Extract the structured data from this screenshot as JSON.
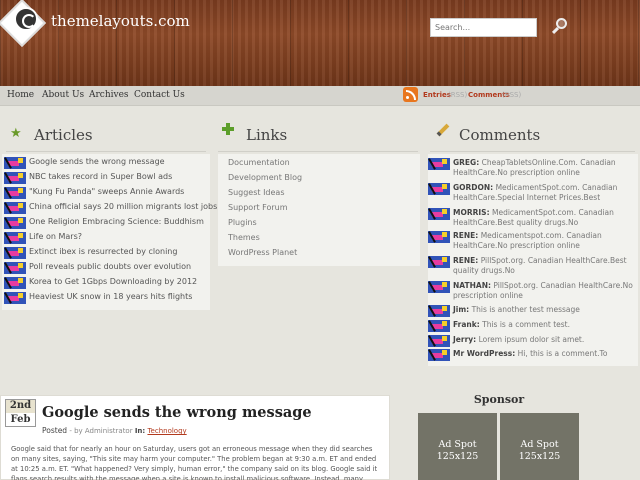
{
  "site": {
    "title": "themelayouts.com"
  },
  "search": {
    "placeholder": "Search..."
  },
  "nav": {
    "items": [
      "Home",
      "About Us",
      "Archives",
      "Contact Us"
    ]
  },
  "rss": {
    "entries": "Entries",
    "entries_tag": "(RSS)",
    "comments": "Comments",
    "comments_tag": "(RSS)"
  },
  "articles": {
    "title": "Articles",
    "items": [
      "Google sends the wrong message",
      "NBC takes record in Super Bowl ads",
      "\"Kung Fu Panda\" sweeps Annie Awards",
      "China official says 20 million migrants lost jobs",
      "One Religion Embracing Science: Buddhism",
      "Life on Mars?",
      "Extinct ibex is resurrected by cloning",
      "Poll reveals public doubts over evolution",
      "Korea to Get 1Gbps Downloading by 2012",
      "Heaviest UK snow in 18 years hits flights"
    ]
  },
  "links": {
    "title": "Links",
    "items": [
      "Documentation",
      "Development Blog",
      "Suggest Ideas",
      "Support Forum",
      "Plugins",
      "Themes",
      "WordPress Planet"
    ]
  },
  "comments": {
    "title": "Comments",
    "items": [
      {
        "author": "GREG:",
        "text": "CheapTabletsOnline.Com. Canadian HealthCare.No prescription online"
      },
      {
        "author": "GORDON:",
        "text": "MedicamentSpot.com. Canadian HealthCare.Special Internet Prices.Best"
      },
      {
        "author": "MORRIS:",
        "text": "MedicamentSpot.com. Canadian HealthCare.Best quality drugs.No"
      },
      {
        "author": "RENE:",
        "text": "Medicamentspot.com. Canadian HealthCare.No prescription online"
      },
      {
        "author": "RENE:",
        "text": "PillSpot.org. Canadian HealthCare.Best quality drugs.No"
      },
      {
        "author": "NATHAN:",
        "text": "PillSpot.org. Canadian HealthCare.No prescription online"
      },
      {
        "author": "Jim:",
        "text": "This is another test message"
      },
      {
        "author": "Frank:",
        "text": "This is a comment test."
      },
      {
        "author": "Jerry:",
        "text": "Lorem ipsum dolor sit amet."
      },
      {
        "author": "Mr WordPress:",
        "text": "Hi, this is a comment.To"
      }
    ]
  },
  "post": {
    "day": "2nd",
    "month": "Feb",
    "title": "Google sends the wrong message",
    "posted_label": "Posted",
    "by": "- by Administrator",
    "in_label": "In:",
    "category": "Technology",
    "body": "Google said that for nearly an hour on Saturday, users got an erroneous message when they did searches on many sites, saying, \"This site may harm your computer.\" The problem began at 9:30 a.m. ET and ended at 10:25 a.m. ET. \"What happened? Very simply, human error,\" the company said on its blog. Google said it flags search results with the message when a site is known to install malicious software. Instead, many other sites were"
  },
  "sponsor": {
    "title": "Sponsor",
    "ads": [
      {
        "line1": "Ad Spot",
        "line2": "125x125"
      },
      {
        "line1": "Ad Spot",
        "line2": "125x125"
      }
    ]
  }
}
